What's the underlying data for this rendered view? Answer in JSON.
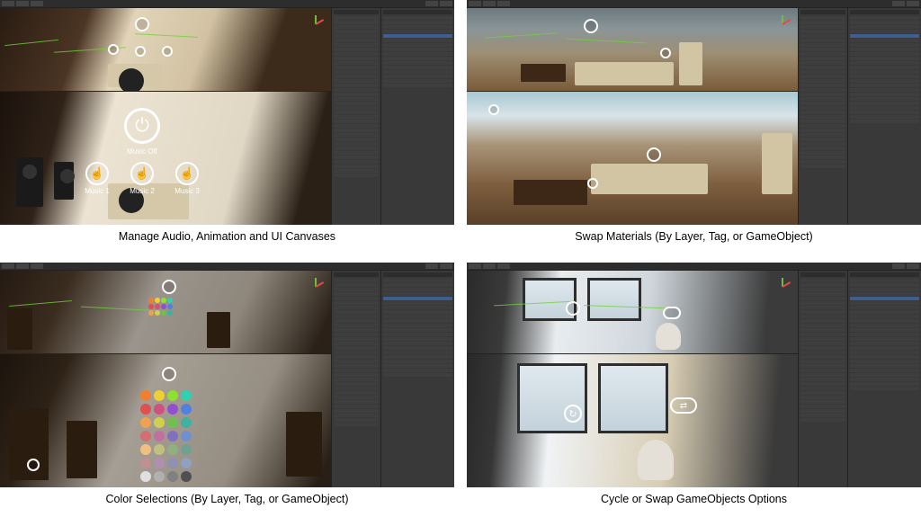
{
  "captions": {
    "audio": "Manage Audio, Animation and UI Canvases",
    "materials": "Swap Materials (By Layer, Tag, or GameObject)",
    "colors": "Color Selections (By Layer, Tag, or GameObject)",
    "gameobjects": "Cycle or Swap GameObjects Options"
  },
  "scene_audio": {
    "power_label": "Music Off",
    "buttons": [
      "Music 1",
      "Music 2",
      "Music 3"
    ]
  },
  "palette": [
    "#f08030",
    "#f0d030",
    "#90e030",
    "#30d0b0",
    "#e05050",
    "#d05080",
    "#9050d0",
    "#5080e0",
    "#f0a050",
    "#d0d050",
    "#70c050",
    "#40b0a0",
    "#d07070",
    "#c070a0",
    "#8070c0",
    "#7090d0",
    "#f0c080",
    "#c0c080",
    "#90b080",
    "#70a090",
    "#c09090",
    "#b090b0",
    "#9090b0",
    "#90a0c0",
    "#e0e0e0",
    "#b0b0b0",
    "#808080",
    "#505050"
  ]
}
